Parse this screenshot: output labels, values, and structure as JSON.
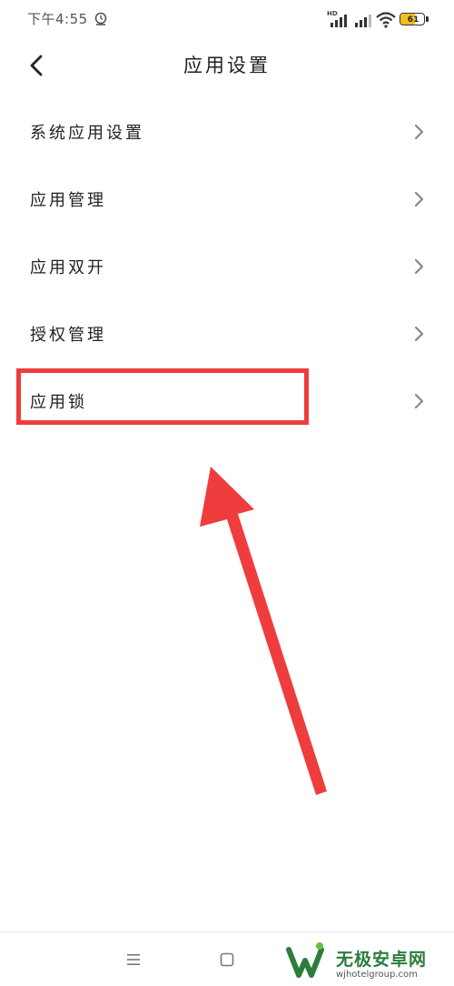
{
  "status_bar": {
    "time": "下午4:55",
    "hd_label": "HD",
    "battery_level": "61",
    "battery_fraction": 0.61,
    "battery_color": "#f2c01a",
    "alarm_icon": "alarm-icon",
    "signal_icon": "signal-icon",
    "wifi_icon": "wifi-icon"
  },
  "header": {
    "title": "应用设置",
    "back_icon": "back-chevron-icon"
  },
  "settings": {
    "items": [
      {
        "label": "系统应用设置"
      },
      {
        "label": "应用管理"
      },
      {
        "label": "应用双开"
      },
      {
        "label": "授权管理"
      },
      {
        "label": "应用锁"
      }
    ],
    "chevron_icon": "chevron-right-icon"
  },
  "annotation": {
    "highlight_target": "应用锁",
    "highlight_color": "#ef3d3d"
  },
  "nav_bar": {
    "menu_icon": "menu-icon",
    "home_icon": "home-icon"
  },
  "watermark": {
    "title": "无极安卓网",
    "url": "wjhotelgroup.com",
    "brand_color": "#2c7d3c"
  }
}
